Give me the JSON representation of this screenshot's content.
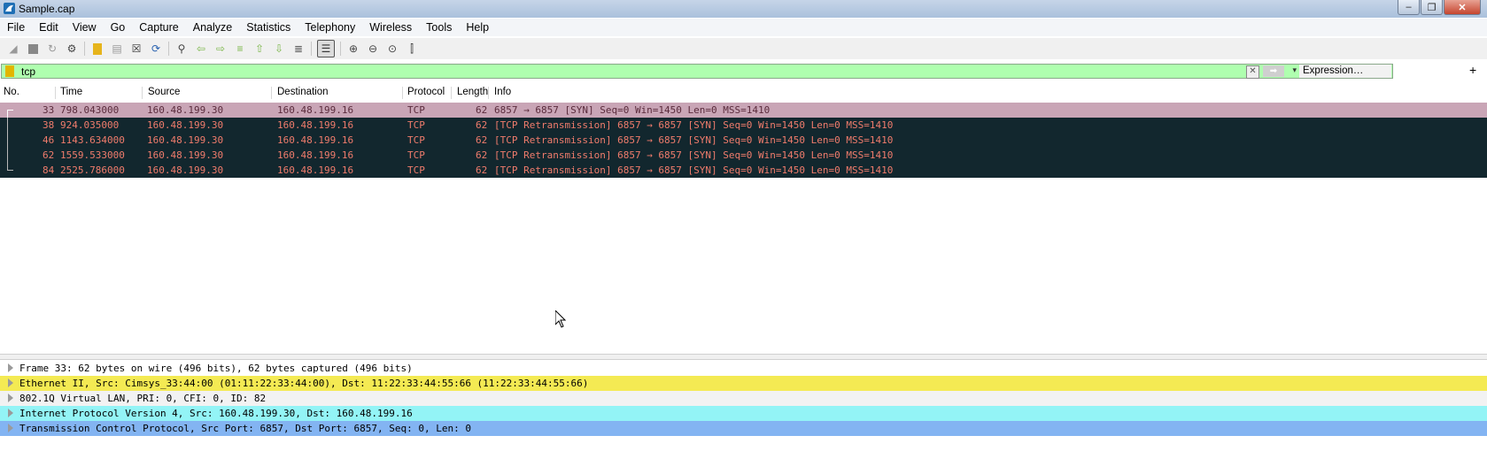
{
  "window": {
    "title": "Sample.cap",
    "buttons": [
      "minimize",
      "restore",
      "close"
    ]
  },
  "menu": [
    "File",
    "Edit",
    "View",
    "Go",
    "Capture",
    "Analyze",
    "Statistics",
    "Telephony",
    "Wireless",
    "Tools",
    "Help"
  ],
  "toolbar": {
    "icons": [
      "shark-fin-start-icon",
      "stop-icon",
      "restart-icon",
      "options-gear-icon",
      "open-folder-icon",
      "save-icon",
      "close-file-icon",
      "reload-icon",
      "find-icon",
      "back-arrow-icon",
      "forward-arrow-icon",
      "go-to-packet-icon",
      "first-packet-icon",
      "last-packet-icon",
      "autoscroll-icon",
      "colorize-icon",
      "zoom-in-icon",
      "zoom-out-icon",
      "normal-size-icon",
      "resize-columns-icon"
    ]
  },
  "filter": {
    "value": "tcp",
    "expression_label": "Expression…",
    "plus_label": "+"
  },
  "packet_list": {
    "columns": [
      "No.",
      "Time",
      "Source",
      "Destination",
      "Protocol",
      "Length",
      "Info"
    ],
    "rows": [
      {
        "no": "33",
        "time": "798.043000",
        "source": "160.48.199.30",
        "destination": "160.48.199.16",
        "protocol": "TCP",
        "length": "62",
        "info": "6857 → 6857 [SYN] Seq=0 Win=1450 Len=0 MSS=1410"
      },
      {
        "no": "38",
        "time": "924.035000",
        "source": "160.48.199.30",
        "destination": "160.48.199.16",
        "protocol": "TCP",
        "length": "62",
        "info": "[TCP Retransmission] 6857 → 6857 [SYN] Seq=0 Win=1450 Len=0 MSS=1410"
      },
      {
        "no": "46",
        "time": "1143.634000",
        "source": "160.48.199.30",
        "destination": "160.48.199.16",
        "protocol": "TCP",
        "length": "62",
        "info": "[TCP Retransmission] 6857 → 6857 [SYN] Seq=0 Win=1450 Len=0 MSS=1410"
      },
      {
        "no": "62",
        "time": "1559.533000",
        "source": "160.48.199.30",
        "destination": "160.48.199.16",
        "protocol": "TCP",
        "length": "62",
        "info": "[TCP Retransmission] 6857 → 6857 [SYN] Seq=0 Win=1450 Len=0 MSS=1410"
      },
      {
        "no": "84",
        "time": "2525.786000",
        "source": "160.48.199.30",
        "destination": "160.48.199.16",
        "protocol": "TCP",
        "length": "62",
        "info": "[TCP Retransmission] 6857 → 6857 [SYN] Seq=0 Win=1450 Len=0 MSS=1410"
      }
    ]
  },
  "details": [
    {
      "text": "Frame 33: 62 bytes on wire (496 bits), 62 bytes captured (496 bits)",
      "color": "#ffffff"
    },
    {
      "text": "Ethernet II, Src: Cimsys_33:44:00 (01:11:22:33:44:00), Dst: 11:22:33:44:55:66 (11:22:33:44:55:66)",
      "color": "#f4ea53"
    },
    {
      "text": "802.1Q Virtual LAN, PRI: 0, CFI: 0, ID: 82",
      "color": "#f2f2f2"
    },
    {
      "text": "Internet Protocol Version 4, Src: 160.48.199.30, Dst: 160.48.199.16",
      "color": "#93f4f6"
    },
    {
      "text": "Transmission Control Protocol, Src Port: 6857, Dst Port: 6857, Seq: 0, Len: 0",
      "color": "#83b4f2"
    }
  ],
  "colors": {
    "row_bg": "#12272e",
    "row_fg": "#f07c6c",
    "selected_row_bg": "#c9a5b6",
    "filter_valid_bg": "#afffaf"
  }
}
